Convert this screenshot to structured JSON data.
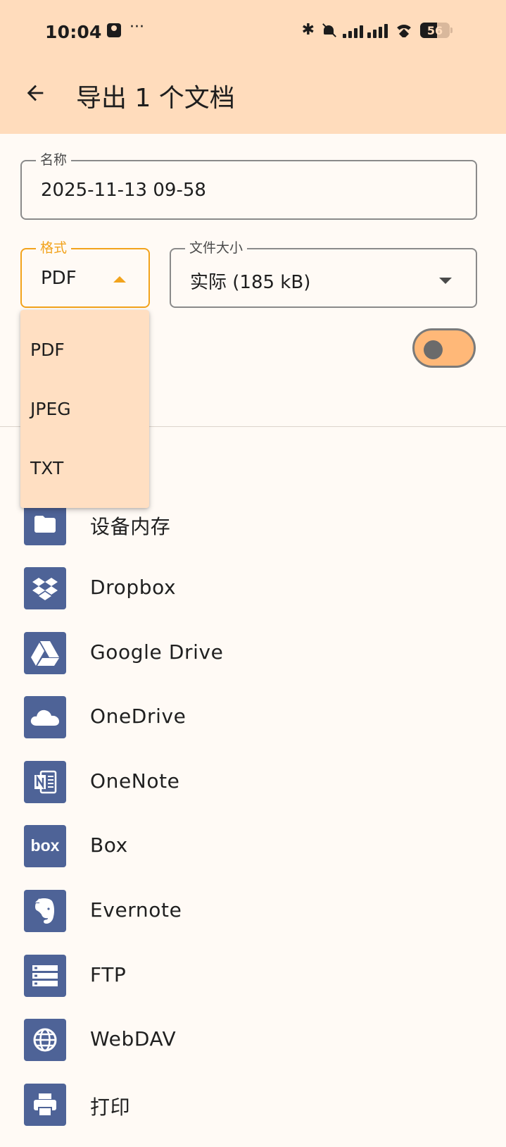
{
  "status_bar": {
    "time": "10:04",
    "more": "···",
    "battery": "56"
  },
  "app_bar": {
    "title": "导出 1 个文档"
  },
  "form": {
    "name": {
      "label": "名称",
      "value": "2025-11-13 09-58"
    },
    "format": {
      "label": "格式",
      "value": "PDF"
    },
    "file_size": {
      "label": "文件大小",
      "value": "实际 (185 kB)"
    },
    "toggle_on": false
  },
  "format_menu": {
    "options": [
      "PDF",
      "JPEG",
      "TXT"
    ]
  },
  "destinations": [
    {
      "label": "设备内存",
      "icon": "folder-icon"
    },
    {
      "label": "Dropbox",
      "icon": "dropbox-icon"
    },
    {
      "label": "Google Drive",
      "icon": "google-drive-icon"
    },
    {
      "label": "OneDrive",
      "icon": "onedrive-icon"
    },
    {
      "label": "OneNote",
      "icon": "onenote-icon"
    },
    {
      "label": "Box",
      "icon": "box-icon"
    },
    {
      "label": "Evernote",
      "icon": "evernote-icon"
    },
    {
      "label": "FTP",
      "icon": "ftp-icon"
    },
    {
      "label": "WebDAV",
      "icon": "webdav-icon"
    },
    {
      "label": "打印",
      "icon": "print-icon"
    }
  ],
  "colors": {
    "header_bg": "#ffdcbc",
    "page_bg": "#fffaf5",
    "accent": "#f2a31c",
    "menu_bg": "#ffdfc2",
    "icon_tile": "#4e6397",
    "toggle_track": "#ffb878"
  }
}
